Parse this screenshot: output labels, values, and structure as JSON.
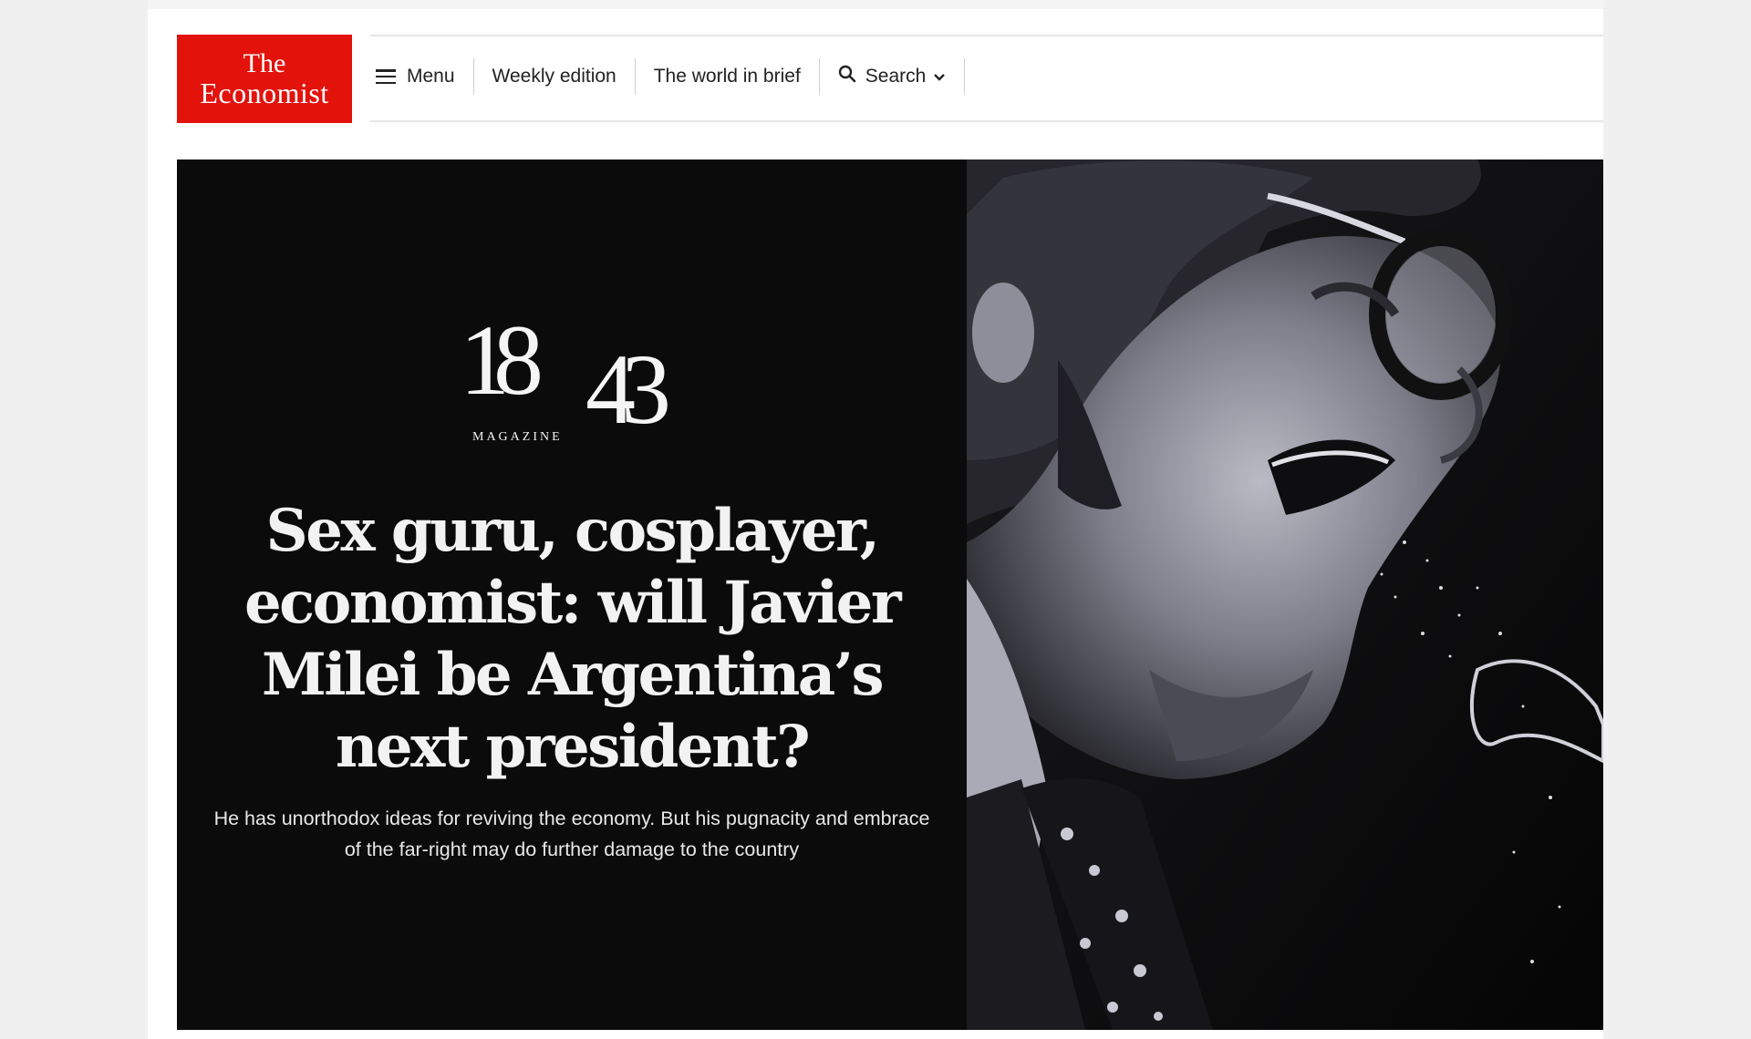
{
  "brand": {
    "name_line1": "The",
    "name_line2": "Economist",
    "color": "#e3120b"
  },
  "nav": {
    "menu_label": "Menu",
    "weekly_label": "Weekly edition",
    "world_label": "The world in brief",
    "search_label": "Search",
    "icons": [
      "hamburger-icon",
      "search-icon",
      "chevron-down-icon"
    ]
  },
  "hero": {
    "magazine": {
      "part1": "18",
      "part2": "43",
      "label": "MAGAZINE"
    },
    "headline": "Sex guru, cosplayer, economist: will Javier Milei be Argentina’s next president?",
    "standfirst": "He has unorthodox ideas for reviving the economy. But his pugnacity and embrace of the far-right may do further damage to the country",
    "background": "#0b0b0b"
  }
}
